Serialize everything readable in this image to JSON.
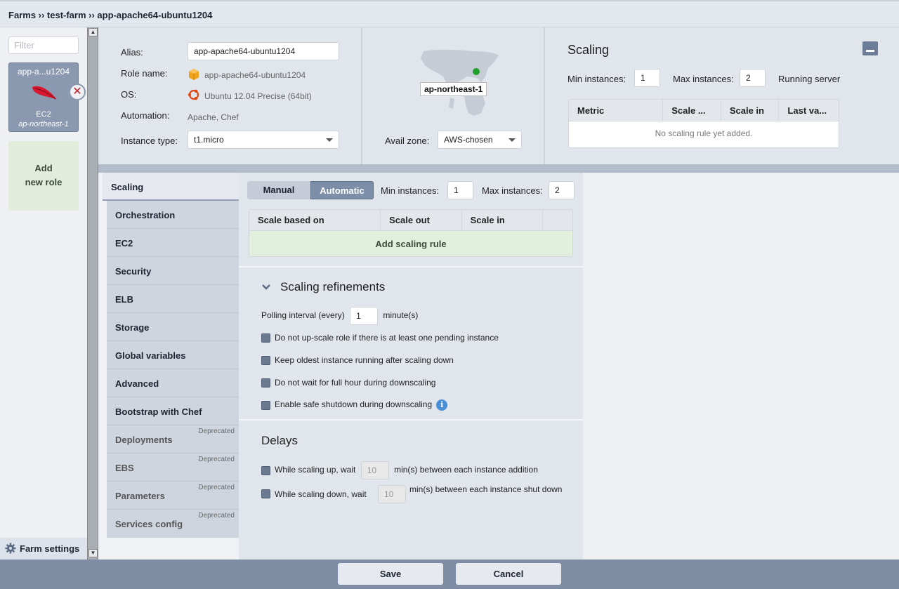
{
  "header": {
    "breadcrumb": "Farms ›› test-farm ›› app-apache64-ubuntu1204"
  },
  "sidebar": {
    "filter_placeholder": "Filter",
    "role": {
      "name": "app-a...u1204",
      "platform": "EC2",
      "location": "ap-northeast-1"
    },
    "add_role_line1": "Add",
    "add_role_line2": "new role",
    "farm_settings": "Farm settings"
  },
  "info": {
    "alias_label": "Alias:",
    "alias_value": "app-apache64-ubuntu1204",
    "role_name_label": "Role name:",
    "role_name_value": "app-apache64-ubuntu1204",
    "os_label": "OS:",
    "os_value": "Ubuntu 12.04 Precise (64bit)",
    "automation_label": "Automation:",
    "automation_value": "Apache, Chef",
    "instance_type_label": "Instance type:",
    "instance_type_value": "t1.micro",
    "region": "ap-northeast-1",
    "avail_zone_label": "Avail zone:",
    "avail_zone_value": "AWS-chosen"
  },
  "scaling_summary": {
    "title": "Scaling",
    "min_label": "Min instances:",
    "min_value": "1",
    "max_label": "Max instances:",
    "max_value": "2",
    "running_label": "Running servers",
    "columns": [
      "Metric",
      "Scale ...",
      "Scale in",
      "Last va..."
    ],
    "empty": "No scaling rule yet added."
  },
  "tabs": [
    {
      "label": "Scaling",
      "deprecated": ""
    },
    {
      "label": "Orchestration",
      "deprecated": ""
    },
    {
      "label": "EC2",
      "deprecated": ""
    },
    {
      "label": "Security",
      "deprecated": ""
    },
    {
      "label": "ELB",
      "deprecated": ""
    },
    {
      "label": "Storage",
      "deprecated": ""
    },
    {
      "label": "Global variables",
      "deprecated": ""
    },
    {
      "label": "Advanced",
      "deprecated": ""
    },
    {
      "label": "Bootstrap with Chef",
      "deprecated": ""
    },
    {
      "label": "Deployments",
      "deprecated": "Deprecated"
    },
    {
      "label": "EBS",
      "deprecated": "Deprecated"
    },
    {
      "label": "Parameters",
      "deprecated": "Deprecated"
    },
    {
      "label": "Services config",
      "deprecated": "Deprecated"
    }
  ],
  "scaling": {
    "manual": "Manual",
    "automatic": "Automatic",
    "min_label": "Min instances:",
    "min_value": "1",
    "max_label": "Max instances:",
    "max_value": "2",
    "columns": [
      "Scale based on",
      "Scale out",
      "Scale in",
      ""
    ],
    "add_rule": "Add scaling rule",
    "refinements_title": "Scaling refinements",
    "polling_label": "Polling interval (every)",
    "polling_value": "1",
    "polling_unit": "minute(s)",
    "options": [
      "Do not up-scale role if there is at least one pending instance",
      "Keep oldest instance running after scaling down",
      "Do not wait for full hour during downscaling",
      "Enable safe shutdown during downscaling"
    ],
    "delays_title": "Delays",
    "delay_up_pre": "While scaling up, wait",
    "delay_up_value": "10",
    "delay_up_post": "min(s) between each instance addition",
    "delay_down_pre": "While scaling down, wait",
    "delay_down_value": "10",
    "delay_down_post": "min(s) between each instance shut down"
  },
  "footer": {
    "save": "Save",
    "cancel": "Cancel"
  }
}
